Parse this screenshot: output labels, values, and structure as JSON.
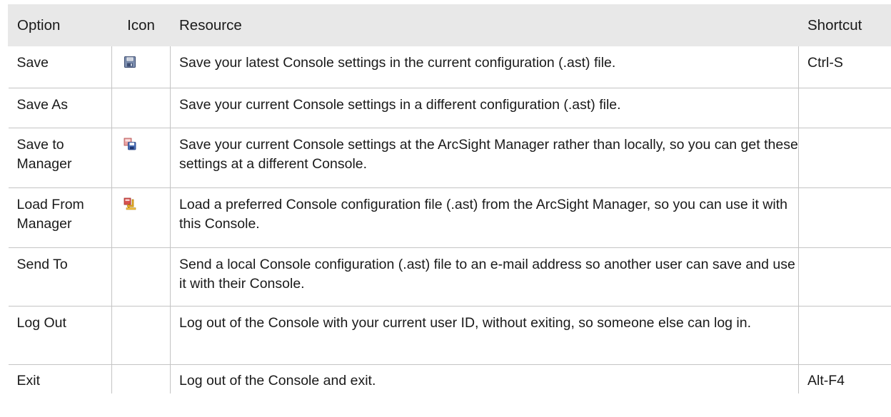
{
  "columns": {
    "option": "Option",
    "icon": "Icon",
    "resource": "Resource",
    "shortcut": "Shortcut"
  },
  "rows": [
    {
      "option": "Save",
      "icon": "save-icon",
      "resource": "Save your latest Console settings in the current configuration (.ast) file.",
      "shortcut": "Ctrl-S"
    },
    {
      "option": "Save As",
      "icon": "",
      "resource": "Save your current Console settings in a different configuration (.ast) file.",
      "shortcut": ""
    },
    {
      "option": "Save to Manager",
      "icon": "save-to-manager-icon",
      "resource": "Save your current Console settings at the ArcSight Manager rather than locally, so you can get these settings at a different Console.",
      "shortcut": ""
    },
    {
      "option": "Load From Manager",
      "icon": "load-from-manager-icon",
      "resource": "Load a preferred Console configuration file (.ast) from the ArcSight Manager, so you can use it with this Console.",
      "shortcut": ""
    },
    {
      "option": "Send To",
      "icon": "",
      "resource": "Send a local Console configuration (.ast) file to an e-mail address so another user can save and use it with their Console.",
      "shortcut": ""
    },
    {
      "option": "Log Out",
      "icon": "",
      "resource": "Log out of the Console with your current user ID, without exiting, so someone else can log in.",
      "shortcut": ""
    },
    {
      "option": "Exit",
      "icon": "",
      "resource": "Log out of the Console and exit.",
      "shortcut": "Alt-F4"
    }
  ]
}
